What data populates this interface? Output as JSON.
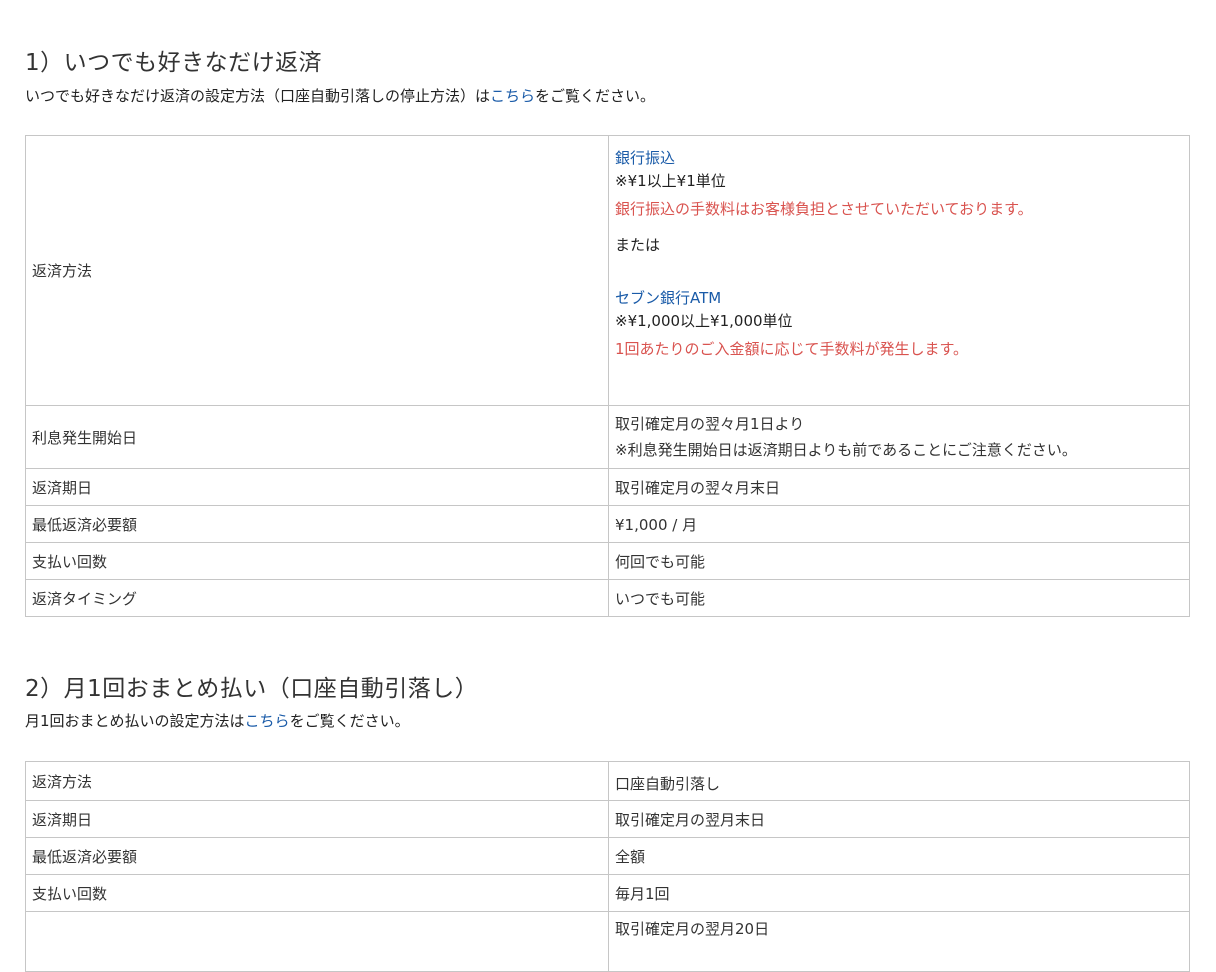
{
  "section1": {
    "title": "1）いつでも好きなだけ返済",
    "desc_before": "いつでも好きなだけ返済の設定方法（口座自動引落しの停止方法）は",
    "desc_link": "こちら",
    "desc_after": "をご覧ください。",
    "rows": {
      "method": {
        "label": "返済方法",
        "bank_transfer": "銀行振込",
        "bank_unit": "※¥1以上¥1単位",
        "bank_fee": "銀行振込の手数料はお客様負担とさせていただいております。",
        "or": "または",
        "seven_atm": "セブン銀行ATM",
        "seven_unit": "※¥1,000以上¥1,000単位",
        "seven_fee": "1回あたりのご入金額に応じて手数料が発生します。"
      },
      "interest_start": {
        "label": "利息発生開始日",
        "value": "取引確定月の翌々月1日より",
        "note": "※利息発生開始日は返済期日よりも前であることにご注意ください。"
      },
      "due_date": {
        "label": "返済期日",
        "value": "取引確定月の翌々月末日"
      },
      "min_payment": {
        "label": "最低返済必要額",
        "value": "¥1,000 / 月"
      },
      "count": {
        "label": "支払い回数",
        "value": "何回でも可能"
      },
      "timing": {
        "label": "返済タイミング",
        "value": "いつでも可能"
      }
    }
  },
  "section2": {
    "title": "2）月1回おまとめ払い（口座自動引落し）",
    "desc_before": "月1回おまとめ払いの設定方法は",
    "desc_link": "こちら",
    "desc_after": "をご覧ください。",
    "rows": {
      "method": {
        "label": "返済方法",
        "value": "口座自動引落し"
      },
      "due_date": {
        "label": "返済期日",
        "value": "取引確定月の翌月末日"
      },
      "min_payment": {
        "label": "最低返済必要額",
        "value": "全額"
      },
      "count": {
        "label": "支払い回数",
        "value": "毎月1回"
      },
      "partial": {
        "value": "取引確定月の翌月20日"
      }
    }
  }
}
